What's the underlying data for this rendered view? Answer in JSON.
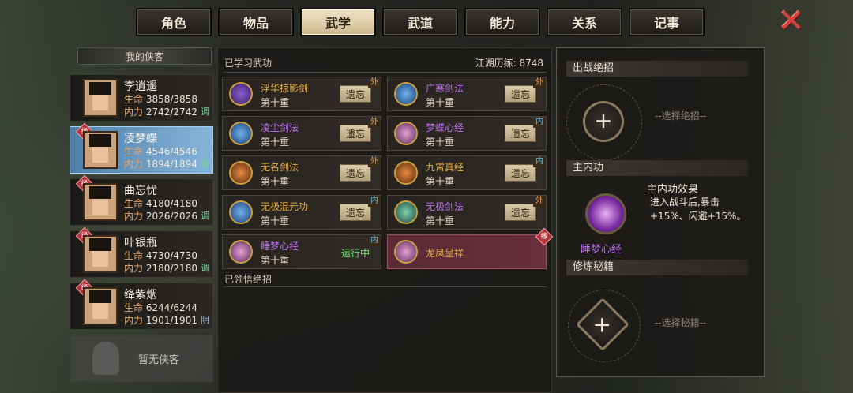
{
  "tabs": [
    "角色",
    "物品",
    "武学",
    "武道",
    "能力",
    "关系",
    "记事"
  ],
  "active_tab": "武学",
  "close_icon": "close-x-icon",
  "list_title": "我的侠客",
  "heroes": [
    {
      "name": "李逍遥",
      "hp": "3858/3858",
      "mp": "2742/2742",
      "tag": "调",
      "badge": ""
    },
    {
      "name": "凌梦蝶",
      "hp": "4546/4546",
      "mp": "1894/1894",
      "tag": "调",
      "badge": "缘"
    },
    {
      "name": "曲忘忧",
      "hp": "4180/4180",
      "mp": "2026/2026",
      "tag": "调",
      "badge": "缘"
    },
    {
      "name": "叶银瓶",
      "hp": "4730/4730",
      "mp": "2180/2180",
      "tag": "调",
      "badge": "缘"
    },
    {
      "name": "绛紫烟",
      "hp": "6244/6244",
      "mp": "1901/1901",
      "tag": "阴",
      "badge": "缘"
    }
  ],
  "labels": {
    "hp": "生命",
    "mp": "内力",
    "forget": "遗忘",
    "running": "运行中"
  },
  "empty_hero": "暂无侠客",
  "learned_header": "已学习武功",
  "exp_label": "江湖历练:",
  "exp_value": "8748",
  "insight_header": "已领悟绝招",
  "skills": [
    {
      "name": "浮华掠影剑",
      "level": "第十重",
      "kind": "外",
      "color": "gold"
    },
    {
      "name": "广寒剑法",
      "level": "第十重",
      "kind": "外",
      "color": "purple"
    },
    {
      "name": "凌尘剑法",
      "level": "第十重",
      "kind": "外",
      "color": "purple"
    },
    {
      "name": "梦蝶心经",
      "level": "第十重",
      "kind": "内",
      "color": "purple"
    },
    {
      "name": "无名剑法",
      "level": "第十重",
      "kind": "外",
      "color": "gold"
    },
    {
      "name": "九霄真经",
      "level": "第十重",
      "kind": "内",
      "color": "gold"
    },
    {
      "name": "无极混元功",
      "level": "第十重",
      "kind": "内",
      "color": "gold"
    },
    {
      "name": "无极剑法",
      "level": "第十重",
      "kind": "外",
      "color": "purple"
    },
    {
      "name": "睡梦心经",
      "level": "第十重",
      "kind": "内",
      "color": "purple"
    },
    {
      "name": "龙凤呈祥",
      "level": "",
      "kind": "缘",
      "color": "gold"
    }
  ],
  "right": {
    "battle_title": "出战绝招",
    "battle_hint": "--选择绝招--",
    "main_title": "主内功",
    "main_name": "睡梦心经",
    "effect_title": "主内功效果",
    "effect_text": "进入战斗后,暴击+15%、闪避+15%。",
    "manual_title": "修炼秘籍",
    "manual_hint": "--选择秘籍--",
    "plus": "+"
  }
}
